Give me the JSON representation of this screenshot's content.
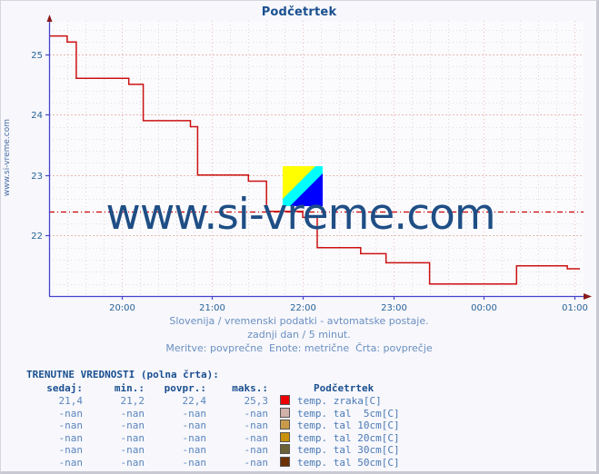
{
  "window": {
    "background": "#f7f7fc"
  },
  "chart": {
    "title": "Podčetrtek",
    "side_watermark": "www.si-vreme.com",
    "center_watermark": "www.si-vreme.com",
    "logo_name": "si-vreme-logo"
  },
  "captions": {
    "line1": "Slovenija / vremenski podatki - avtomatske postaje.",
    "line2": "zadnji dan / 5 minut.",
    "line3": "Meritve: povprečne  Enote: metrične  Črta: povprečje"
  },
  "table": {
    "heading": "TRENUTNE VREDNOSTI (polna črta):",
    "columns": [
      "sedaj:",
      "min.:",
      "povpr.:",
      "maks.:",
      "Podčetrtek"
    ],
    "rows": [
      {
        "sedaj": "21,4",
        "min": "21,2",
        "povpr": "22,4",
        "maks": "25,3",
        "color": "#ee0000",
        "label": "temp. zraka[C]"
      },
      {
        "sedaj": "-nan",
        "min": "-nan",
        "povpr": "-nan",
        "maks": "-nan",
        "color": "#d2b1ab",
        "label": "temp. tal  5cm[C]"
      },
      {
        "sedaj": "-nan",
        "min": "-nan",
        "povpr": "-nan",
        "maks": "-nan",
        "color": "#c89a4a",
        "label": "temp. tal 10cm[C]"
      },
      {
        "sedaj": "-nan",
        "min": "-nan",
        "povpr": "-nan",
        "maks": "-nan",
        "color": "#c8920a",
        "label": "temp. tal 20cm[C]"
      },
      {
        "sedaj": "-nan",
        "min": "-nan",
        "povpr": "-nan",
        "maks": "-nan",
        "color": "#6b6136",
        "label": "temp. tal 30cm[C]"
      },
      {
        "sedaj": "-nan",
        "min": "-nan",
        "povpr": "-nan",
        "maks": "-nan",
        "color": "#6b3205",
        "label": "temp. tal 50cm[C]"
      }
    ]
  },
  "chart_data": {
    "type": "line",
    "title": "Podčetrtek",
    "xlabel": "",
    "ylabel": "",
    "series_name": "temp. zraka[C]",
    "series_color": "#cc1111",
    "average_line": 22.4,
    "average_line_color": "#cc0000",
    "grid": true,
    "ylim": [
      21.0,
      25.55
    ],
    "y_ticks": [
      22,
      23,
      24,
      25
    ],
    "x_ticks": [
      "20:00",
      "21:00",
      "22:00",
      "23:00",
      "00:00",
      "01:00"
    ],
    "x_tick_hours": [
      20,
      21,
      22,
      23,
      24,
      25
    ],
    "x_range_hours": [
      19.2,
      25.1
    ],
    "stats": {
      "sedaj": 21.4,
      "min": 21.2,
      "povpr": 22.4,
      "maks": 25.3
    },
    "points": [
      {
        "t": 19.2,
        "v": 25.3
      },
      {
        "t": 19.38,
        "v": 25.3
      },
      {
        "t": 19.4,
        "v": 25.2
      },
      {
        "t": 19.48,
        "v": 25.2
      },
      {
        "t": 19.5,
        "v": 24.6
      },
      {
        "t": 20.05,
        "v": 24.6
      },
      {
        "t": 20.08,
        "v": 24.5
      },
      {
        "t": 20.2,
        "v": 24.5
      },
      {
        "t": 20.24,
        "v": 23.9
      },
      {
        "t": 20.72,
        "v": 23.9
      },
      {
        "t": 20.76,
        "v": 23.8
      },
      {
        "t": 20.8,
        "v": 23.8
      },
      {
        "t": 20.84,
        "v": 23.0
      },
      {
        "t": 21.36,
        "v": 23.0
      },
      {
        "t": 21.4,
        "v": 22.9
      },
      {
        "t": 21.56,
        "v": 22.9
      },
      {
        "t": 21.6,
        "v": 22.4
      },
      {
        "t": 21.96,
        "v": 22.4
      },
      {
        "t": 22.0,
        "v": 22.3
      },
      {
        "t": 22.12,
        "v": 22.3
      },
      {
        "t": 22.16,
        "v": 21.8
      },
      {
        "t": 22.6,
        "v": 21.8
      },
      {
        "t": 22.64,
        "v": 21.7
      },
      {
        "t": 22.88,
        "v": 21.7
      },
      {
        "t": 22.92,
        "v": 21.55
      },
      {
        "t": 23.36,
        "v": 21.55
      },
      {
        "t": 23.4,
        "v": 21.2
      },
      {
        "t": 24.32,
        "v": 21.2
      },
      {
        "t": 24.36,
        "v": 21.5
      },
      {
        "t": 24.88,
        "v": 21.5
      },
      {
        "t": 24.92,
        "v": 21.45
      },
      {
        "t": 25.06,
        "v": 21.45
      }
    ]
  },
  "axis": {
    "axis_color": "#4444cc",
    "grid_major_color": "#e8b0a8",
    "grid_minor_color": "#cccccc"
  }
}
